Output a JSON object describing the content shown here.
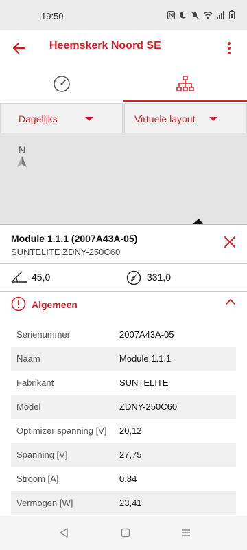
{
  "status_bar": {
    "time": "19:50",
    "icons": [
      "nfc-icon",
      "moon-icon",
      "mute-icon",
      "wifi-icon",
      "signal-icon",
      "battery-icon"
    ]
  },
  "app_bar": {
    "title": "Heemskerk Noord SE",
    "back_icon": "arrow-left-icon",
    "menu_icon": "more-vertical-icon"
  },
  "tabs": [
    {
      "icon": "gauge-icon",
      "active": false
    },
    {
      "icon": "hierarchy-icon",
      "active": true
    }
  ],
  "filters": {
    "period": "Dagelijks",
    "view": "Virtuele layout"
  },
  "map": {
    "north_label": "N"
  },
  "module": {
    "title": "Module 1.1.1 (2007A43A-05)",
    "subtitle": "SUNTELITE ZDNY-250C60",
    "tilt": "45,0",
    "azimuth": "331,0"
  },
  "section": {
    "title": "Algemeen",
    "rows": [
      {
        "label": "Serienummer",
        "value": "2007A43A-05"
      },
      {
        "label": "Naam",
        "value": "Module 1.1.1"
      },
      {
        "label": "Fabrikant",
        "value": "SUNTELITE"
      },
      {
        "label": "Model",
        "value": "ZDNY-250C60"
      },
      {
        "label": "Optimizer spanning [V]",
        "value": "20,12"
      },
      {
        "label": "Spanning [V]",
        "value": "27,75"
      },
      {
        "label": "Stroom [A]",
        "value": "0,84"
      },
      {
        "label": "Vermogen [W]",
        "value": "23,41"
      }
    ]
  },
  "colors": {
    "accent": "#d81e25",
    "row_alt": "#f0f0f0",
    "map_bg": "#e4e4e4"
  }
}
